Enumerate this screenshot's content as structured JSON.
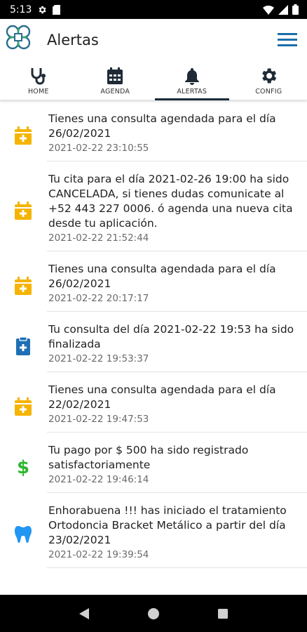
{
  "status_bar": {
    "time": "5:13"
  },
  "app": {
    "title": "Alertas"
  },
  "tabs": [
    {
      "label": "HOME",
      "icon": "stethoscope-icon",
      "active": false
    },
    {
      "label": "AGENDA",
      "icon": "calendar-icon",
      "active": false
    },
    {
      "label": "ALERTAS",
      "icon": "bell-icon",
      "active": true
    },
    {
      "label": "CONFIG",
      "icon": "gear-icon",
      "active": false
    }
  ],
  "colors": {
    "accent": "#1b6fa8",
    "calendar": "#f5b400",
    "money": "#2db82d",
    "tooth": "#2196f3",
    "clipboard": "#1e6fb5"
  },
  "alerts": [
    {
      "icon": "calendar-plus-icon",
      "text": "Tienes una consulta agendada para el día 26/02/2021",
      "date": "2021-02-22 23:10:55"
    },
    {
      "icon": "calendar-plus-icon",
      "text": "Tu cita para el día 2021-02-26 19:00 ha sido CANCELADA, si tienes dudas comunicate al +52 443 227 0006. ó agenda una nueva cita desde tu aplicación.",
      "date": "2021-02-22 21:52:44"
    },
    {
      "icon": "calendar-plus-icon",
      "text": "Tienes una consulta agendada para el día 26/02/2021",
      "date": "2021-02-22 20:17:17"
    },
    {
      "icon": "clipboard-plus-icon",
      "text": "Tu consulta del día 2021-02-22 19:53 ha sido finalizada",
      "date": "2021-02-22 19:53:37"
    },
    {
      "icon": "calendar-plus-icon",
      "text": "Tienes una consulta agendada para el día 22/02/2021",
      "date": "2021-02-22 19:47:53"
    },
    {
      "icon": "dollar-icon",
      "text": "Tu pago por $ 500 ha sido registrado satisfactoriamente",
      "date": "2021-02-22 19:46:14"
    },
    {
      "icon": "tooth-icon",
      "text": "Enhorabuena !!! has iniciado el tratamiento Ortodoncia Bracket Metálico a partir del día 23/02/2021",
      "date": "2021-02-22 19:39:54"
    }
  ]
}
